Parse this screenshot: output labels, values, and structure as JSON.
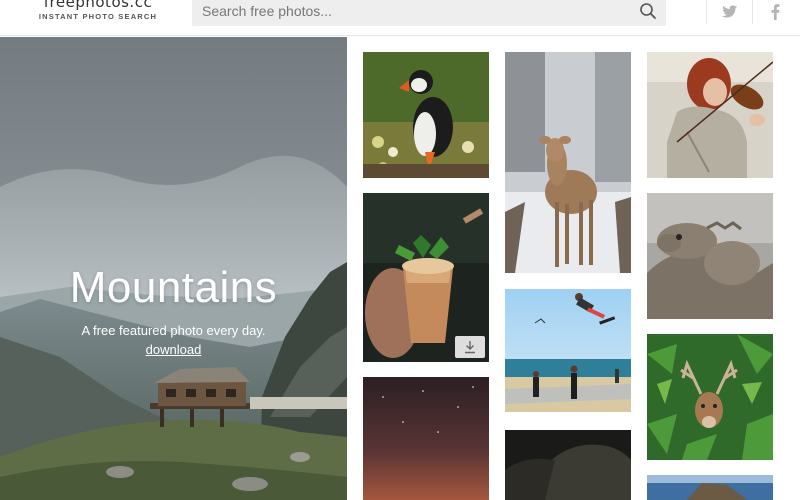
{
  "header": {
    "logo_name": "freephotos.cc",
    "logo_tagline": "INSTANT PHOTO SEARCH",
    "search_placeholder": "Search free photos...",
    "search_icon": "search-icon",
    "social_icons": [
      "twitter-icon",
      "facebook-icon"
    ]
  },
  "hero": {
    "title": "Mountains",
    "subtitle": "A free featured photo every day.",
    "link": "download"
  },
  "grid": {
    "photos": [
      {
        "subject": "puffin"
      },
      {
        "subject": "deer-in-snow"
      },
      {
        "subject": "violinist"
      },
      {
        "subject": "cocktail"
      },
      {
        "subject": "iguana"
      },
      {
        "subject": "skateboarder-beach"
      },
      {
        "subject": "deer-in-ferns"
      },
      {
        "subject": "night-sky"
      },
      {
        "subject": "cave"
      },
      {
        "subject": "coast"
      }
    ],
    "download_icon": "download-icon"
  },
  "colors": {
    "search_bg": "#eeeeee",
    "border": "#e6e6e6",
    "social_icon": "#b5b5b5"
  }
}
